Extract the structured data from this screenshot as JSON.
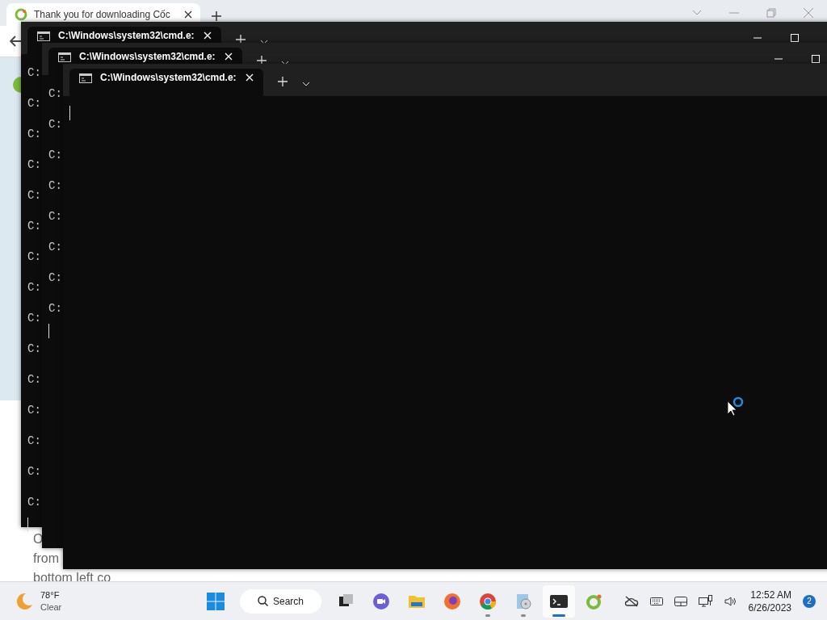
{
  "browser": {
    "tab_title": "Thank you for downloading Cốc",
    "page_lines": [
      "O",
      "from",
      "bottom left co"
    ]
  },
  "terminals": [
    {
      "tab_title": "C:\\Windows\\system32\\cmd.e:",
      "maximize_visible": true,
      "lines": [
        "C:",
        "C:",
        "C:",
        "C:",
        "C:",
        "C:",
        "C:",
        "C:",
        "C:",
        "C:",
        "C:",
        "C:",
        "C:",
        "C:",
        "C:"
      ]
    },
    {
      "tab_title": "C:\\Windows\\system32\\cmd.e:",
      "maximize_visible": true,
      "lines": [
        "C:",
        "C:",
        "C:",
        "C:",
        "C:",
        "C:",
        "C:",
        "C:"
      ]
    },
    {
      "tab_title": "C:\\Windows\\system32\\cmd.e:",
      "maximize_visible": false
    }
  ],
  "taskbar": {
    "weather": {
      "temperature": "78°F",
      "condition": "Clear"
    },
    "search_label": "Search",
    "apps": [
      {
        "kind": "taskview",
        "running": false,
        "active": false
      },
      {
        "kind": "chat",
        "running": false,
        "active": false
      },
      {
        "kind": "files",
        "running": false,
        "active": false
      },
      {
        "kind": "firefox",
        "running": false,
        "active": false
      },
      {
        "kind": "chrome",
        "running": true,
        "active": false
      },
      {
        "kind": "installer",
        "running": true,
        "active": false
      },
      {
        "kind": "terminal",
        "running": true,
        "active": true
      },
      {
        "kind": "coccoc",
        "running": false,
        "active": false
      }
    ],
    "time": "12:52 AM",
    "date": "6/26/2023",
    "notification_count": "2"
  }
}
